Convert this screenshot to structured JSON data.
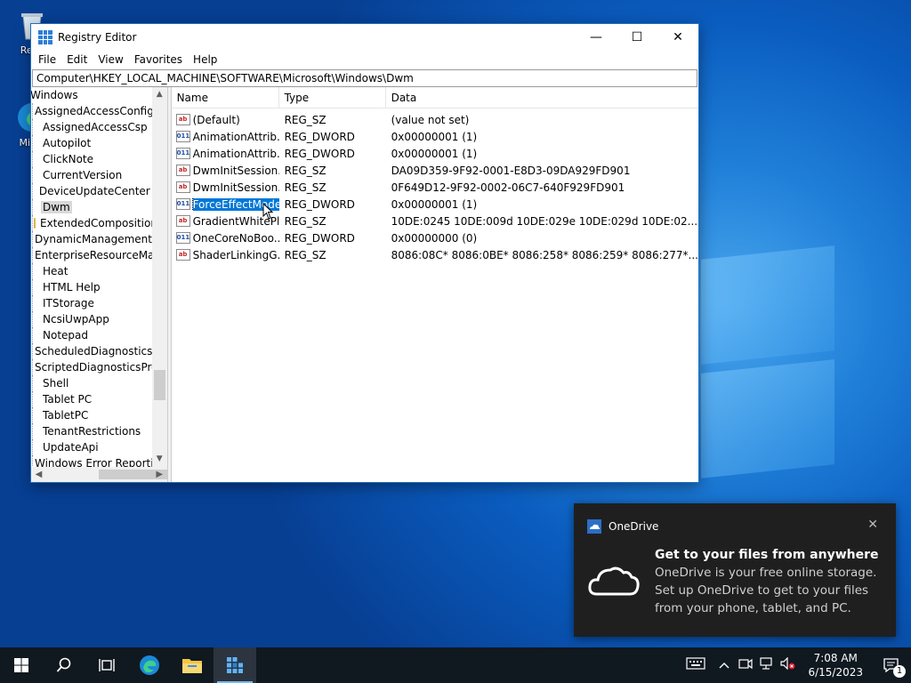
{
  "desktop": {
    "icons": [
      {
        "label": "Recy"
      },
      {
        "label": "Mic E"
      }
    ]
  },
  "window": {
    "title": "Registry Editor",
    "minimize_glyph": "—",
    "maximize_glyph": "☐",
    "close_glyph": "✕",
    "menu": [
      "File",
      "Edit",
      "View",
      "Favorites",
      "Help"
    ],
    "address": "Computer\\HKEY_LOCAL_MACHINE\\SOFTWARE\\Microsoft\\Windows\\Dwm"
  },
  "tree": {
    "items": [
      {
        "label": "Windows",
        "level": 0
      },
      {
        "label": "AssignedAccessConfiguration",
        "level": 1
      },
      {
        "label": "AssignedAccessCsp",
        "level": 1
      },
      {
        "label": "Autopilot",
        "level": 1
      },
      {
        "label": "ClickNote",
        "level": 1
      },
      {
        "label": "CurrentVersion",
        "level": 1
      },
      {
        "label": "DeviceUpdateCenter",
        "level": 1
      },
      {
        "label": "Dwm",
        "level": 1,
        "selected": true
      },
      {
        "label": "ExtendedComposition",
        "level": 2
      },
      {
        "label": "DynamicManagement",
        "level": 1
      },
      {
        "label": "EnterpriseResourceManager",
        "level": 1
      },
      {
        "label": "Heat",
        "level": 1
      },
      {
        "label": "HTML Help",
        "level": 1
      },
      {
        "label": "ITStorage",
        "level": 1
      },
      {
        "label": "NcsiUwpApp",
        "level": 1
      },
      {
        "label": "Notepad",
        "level": 1
      },
      {
        "label": "ScheduledDiagnostics",
        "level": 1
      },
      {
        "label": "ScriptedDiagnosticsProvider",
        "level": 1
      },
      {
        "label": "Shell",
        "level": 1
      },
      {
        "label": "Tablet PC",
        "level": 1
      },
      {
        "label": "TabletPC",
        "level": 1
      },
      {
        "label": "TenantRestrictions",
        "level": 1
      },
      {
        "label": "UpdateApi",
        "level": 1
      },
      {
        "label": "Windows Error Reporting",
        "level": 1
      }
    ]
  },
  "values": {
    "columns": {
      "name": "Name",
      "type": "Type",
      "data": "Data"
    },
    "rows": [
      {
        "icon": "string-value-icon",
        "kind": "sz",
        "name": "(Default)",
        "type": "REG_SZ",
        "data": "(value not set)"
      },
      {
        "icon": "dword-value-icon",
        "kind": "dw",
        "name": "AnimationAttrib...",
        "type": "REG_DWORD",
        "data": "0x00000001 (1)"
      },
      {
        "icon": "dword-value-icon",
        "kind": "dw",
        "name": "AnimationAttrib...",
        "type": "REG_DWORD",
        "data": "0x00000001 (1)"
      },
      {
        "icon": "string-value-icon",
        "kind": "sz",
        "name": "DwmInitSession...",
        "type": "REG_SZ",
        "data": "DA09D359-9F92-0001-E8D3-09DA929FD901"
      },
      {
        "icon": "string-value-icon",
        "kind": "sz",
        "name": "DwmInitSession...",
        "type": "REG_SZ",
        "data": "0F649D12-9F92-0002-06C7-640F929FD901"
      },
      {
        "icon": "dword-value-icon",
        "kind": "dw",
        "name": "ForceEffectMode",
        "type": "REG_DWORD",
        "data": "0x00000001 (1)",
        "selected": true
      },
      {
        "icon": "string-value-icon",
        "kind": "sz",
        "name": "GradientWhitePl...",
        "type": "REG_SZ",
        "data": "10DE:0245 10DE:009d 10DE:029e 10DE:029d 10DE:02..."
      },
      {
        "icon": "dword-value-icon",
        "kind": "dw",
        "name": "OneCoreNoBoo...",
        "type": "REG_DWORD",
        "data": "0x00000000 (0)"
      },
      {
        "icon": "string-value-icon",
        "kind": "sz",
        "name": "ShaderLinkingG...",
        "type": "REG_SZ",
        "data": "8086:08C* 8086:0BE* 8086:258* 8086:259* 8086:277*..."
      }
    ]
  },
  "toast": {
    "app": "OneDrive",
    "title": "Get to your files from anywhere",
    "lines": [
      "OneDrive is your free online storage.",
      "Set up OneDrive to get to your files",
      "from your phone, tablet, and PC."
    ],
    "close_glyph": "✕"
  },
  "taskbar": {
    "time": "7:08 AM",
    "date": "6/15/2023",
    "notification_count": "1"
  },
  "colors": {
    "selection": "#0078d7",
    "taskbar": "#101820",
    "toast_bg": "#1f1f1f"
  }
}
